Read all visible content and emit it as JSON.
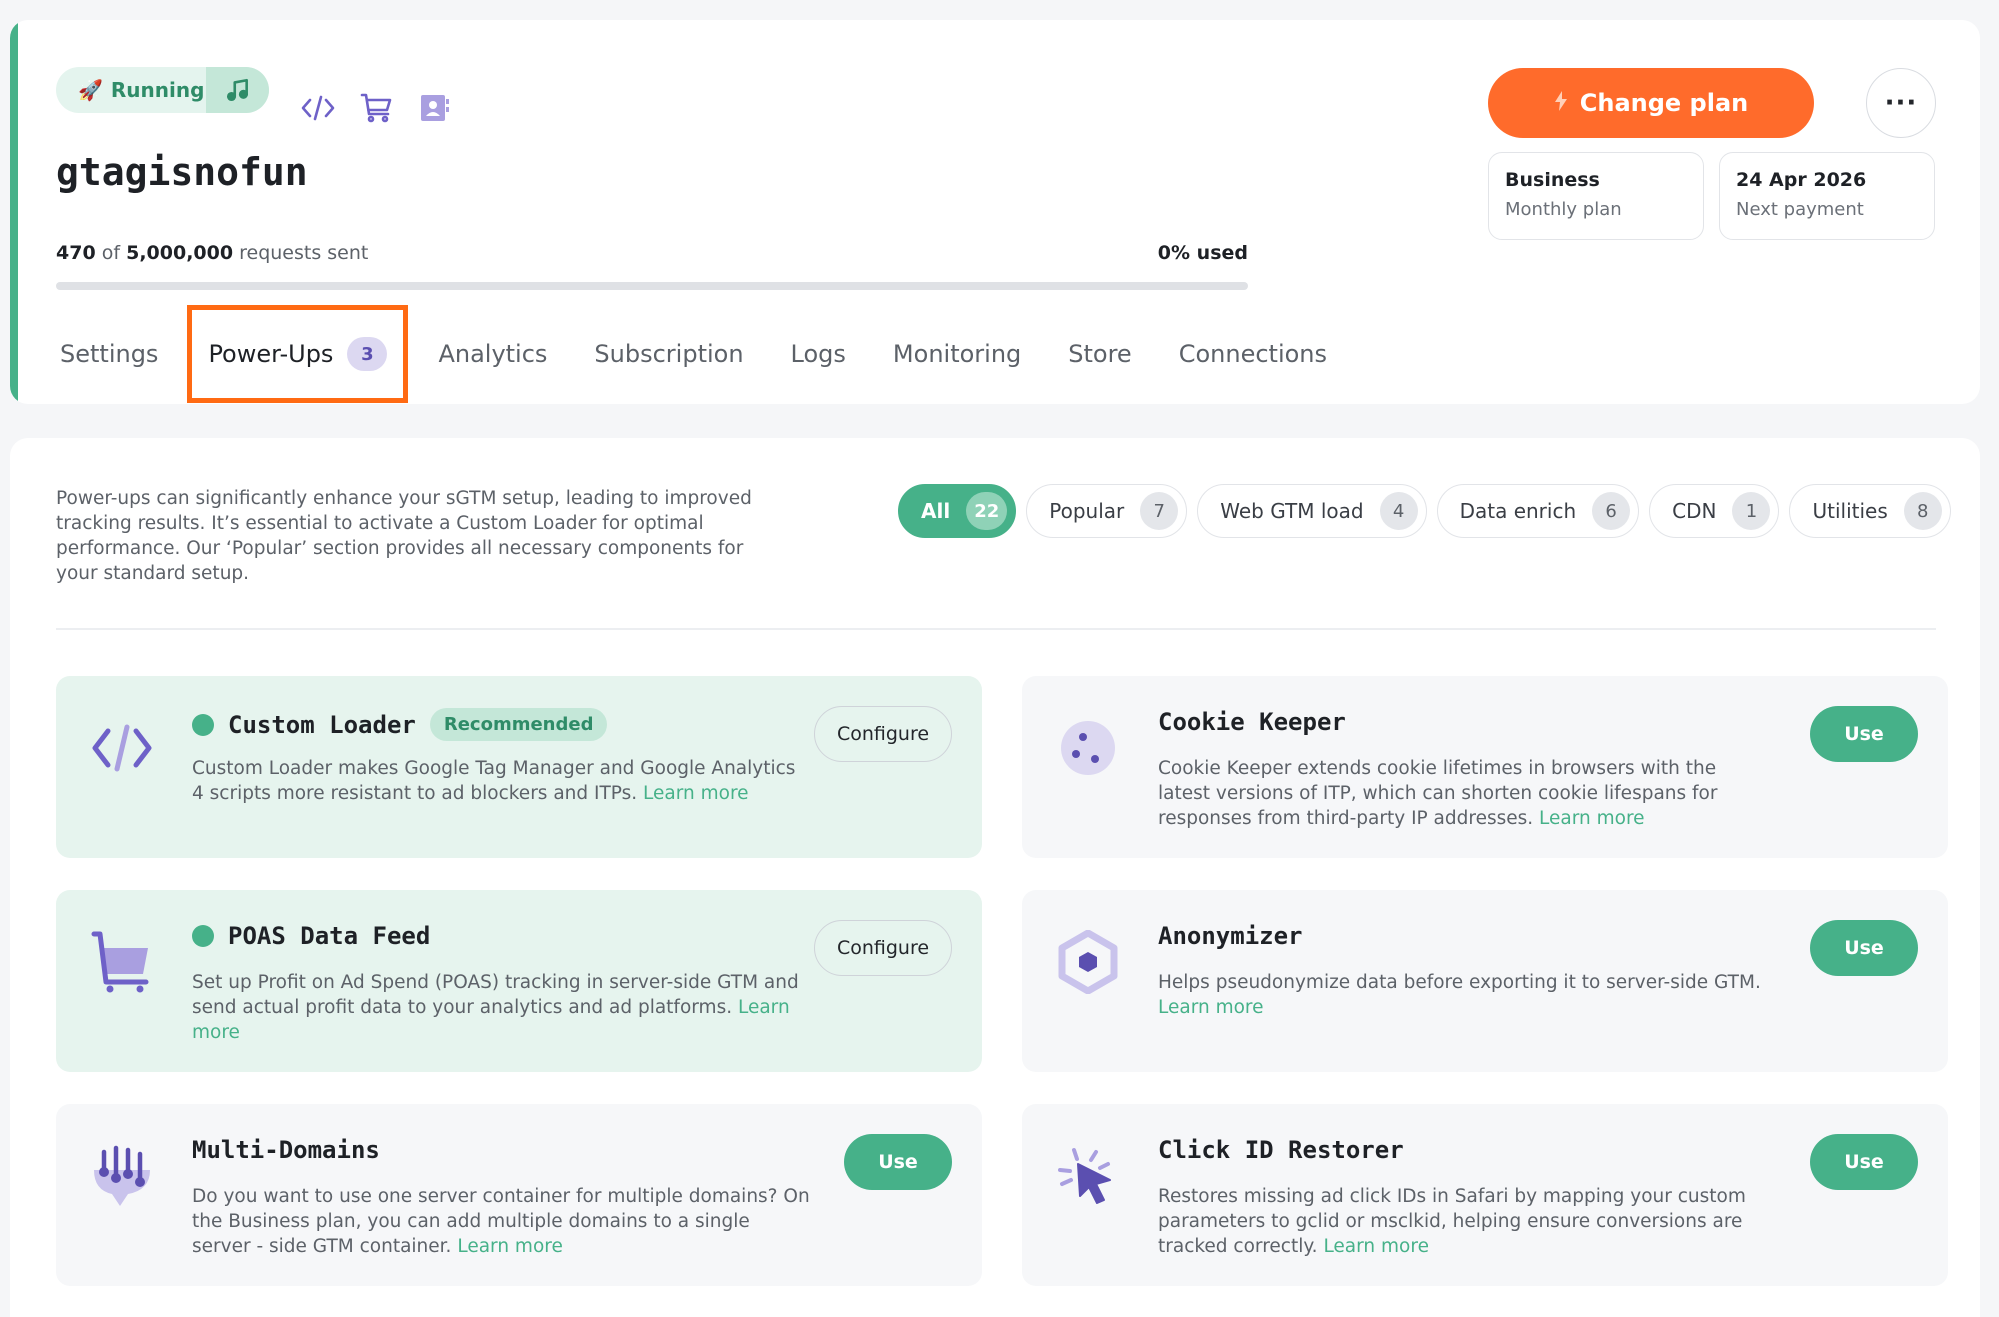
{
  "header": {
    "status": "Running",
    "container_name": "gtagisnofun",
    "usage": {
      "used": "470",
      "of_label": "of",
      "total": "5,000,000",
      "suffix": "requests sent",
      "percent_label": "0% used",
      "percent": 0
    },
    "change_plan_label": "Change plan",
    "more_label": "···",
    "plan": {
      "name": "Business",
      "type": "Monthly plan"
    },
    "payment": {
      "date": "24 Apr 2026",
      "label": "Next payment"
    }
  },
  "tabs": [
    {
      "label": "Settings"
    },
    {
      "label": "Power-Ups",
      "count": "3",
      "active": true
    },
    {
      "label": "Analytics"
    },
    {
      "label": "Subscription"
    },
    {
      "label": "Logs"
    },
    {
      "label": "Monitoring"
    },
    {
      "label": "Store"
    },
    {
      "label": "Connections"
    }
  ],
  "intro": "Power-ups can significantly enhance your sGTM setup, leading to improved tracking results. It’s essential to activate a Custom Loader for optimal performance. Our ‘Popular’ section provides all necessary components for your standard setup.",
  "filters": [
    {
      "label": "All",
      "count": "22"
    },
    {
      "label": "Popular",
      "count": "7"
    },
    {
      "label": "Web GTM load",
      "count": "4"
    },
    {
      "label": "Data enrich",
      "count": "6"
    },
    {
      "label": "CDN",
      "count": "1"
    },
    {
      "label": "Utilities",
      "count": "8"
    }
  ],
  "learn_more": "Learn more",
  "powerups": [
    {
      "title": "Custom Loader",
      "badge": "Recommended",
      "desc": "Custom Loader makes Google Tag Manager and Google Analytics 4 scripts more resistant to ad blockers and ITPs.",
      "action": "Configure",
      "icon": "code-icon"
    },
    {
      "title": "Cookie Keeper",
      "desc": "Cookie Keeper extends cookie lifetimes in browsers with the latest versions of ITP, which can shorten cookie lifespans for responses from third-party IP addresses.",
      "action": "Use",
      "icon": "cookie-icon"
    },
    {
      "title": "POAS Data Feed",
      "desc": "Set up Profit on Ad Spend (POAS) tracking in server-side GTM and send actual profit data to your analytics and ad platforms.",
      "action": "Configure",
      "icon": "cart-icon"
    },
    {
      "title": "Anonymizer",
      "desc": "Helps pseudonymize data before exporting it to server-side GTM.",
      "action": "Use",
      "icon": "hexagon-icon"
    },
    {
      "title": "Multi-Domains",
      "desc": "Do you want to use one server container for multiple domains? On the Business plan, you can add multiple domains to a single server - side GTM container.",
      "action": "Use",
      "icon": "multi-domains-icon"
    },
    {
      "title": "Click ID Restorer",
      "desc": "Restores missing ad click IDs in Safari by mapping your custom parameters to gclid or msclkid, helping ensure conversions are tracked correctly.",
      "action": "Use",
      "icon": "cursor-click-icon"
    }
  ],
  "colors": {
    "accent": "#46b189",
    "orange": "#ff6b2b",
    "purple": "#6e61c8"
  }
}
